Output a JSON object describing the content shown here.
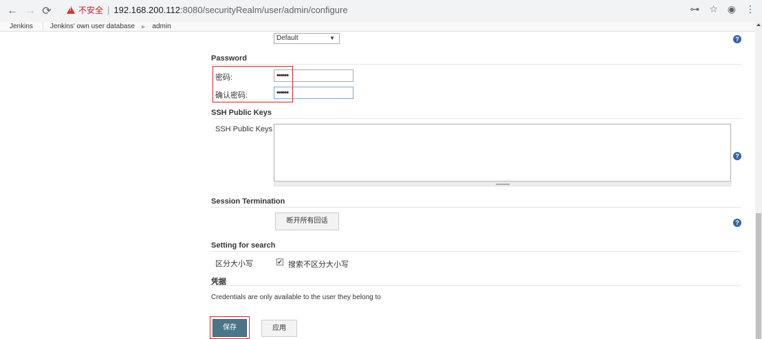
{
  "browser": {
    "security_warning": "不安全",
    "url_host": "192.168.200.112",
    "url_rest": ":8080/securityRealm/user/admin/configure"
  },
  "breadcrumbs": [
    "Jenkins",
    "Jenkins' own user database",
    "admin"
  ],
  "top_select": {
    "value": "Default"
  },
  "password": {
    "title": "Password",
    "password_label": "密码:",
    "password_value": "••••••",
    "confirm_label": "确认密码:",
    "confirm_value": "••••••"
  },
  "ssh": {
    "title": "SSH Public Keys",
    "field_label": "SSH Public Keys"
  },
  "session": {
    "title": "Session Termination",
    "button_label": "断开所有回话"
  },
  "search": {
    "title": "Setting for search",
    "label": "区分大小写",
    "checkbox_label": "搜索不区分大小写",
    "checkbox_mark": "✔"
  },
  "credentials": {
    "title": "凭据",
    "note": "Credentials are only available to the user they belong to"
  },
  "actions": {
    "save_label": "保存",
    "apply_label": "应用"
  },
  "colors": {
    "primary_button": "#4b758b",
    "highlight_box": "#e02020",
    "help_icon": "#3465a4"
  }
}
